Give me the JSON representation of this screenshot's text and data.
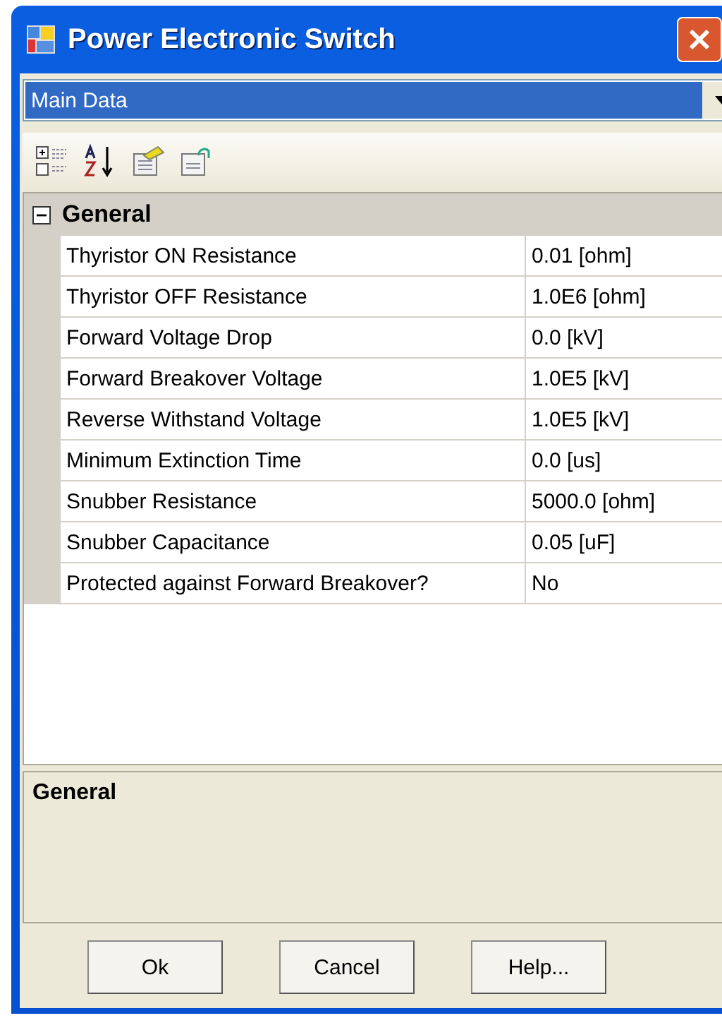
{
  "window": {
    "title": "Power Electronic Switch"
  },
  "dropdown": {
    "value": "Main Data"
  },
  "toolbar": [
    {
      "kind": "categorized"
    },
    {
      "kind": "alphabetical"
    },
    {
      "kind": "property-pages"
    },
    {
      "kind": "export"
    }
  ],
  "category": {
    "label": "General",
    "expanded": true
  },
  "properties": [
    {
      "name": "Thyristor ON  Resistance",
      "value": "0.01 [ohm]"
    },
    {
      "name": "Thyristor OFF Resistance",
      "value": "1.0E6 [ohm]"
    },
    {
      "name": "Forward Voltage Drop",
      "value": "0.0 [kV]"
    },
    {
      "name": "Forward Breakover Voltage",
      "value": "1.0E5 [kV]"
    },
    {
      "name": "Reverse Withstand Voltage",
      "value": "1.0E5 [kV]"
    },
    {
      "name": "Minimum Extinction Time",
      "value": "0.0 [us]"
    },
    {
      "name": "Snubber Resistance",
      "value": "5000.0 [ohm]"
    },
    {
      "name": "Snubber Capacitance",
      "value": "0.05 [uF]"
    },
    {
      "name": "Protected against Forward Breakover?",
      "value": "No"
    }
  ],
  "description": {
    "title": "General"
  },
  "buttons": [
    "Ok",
    "Cancel",
    "Help..."
  ]
}
